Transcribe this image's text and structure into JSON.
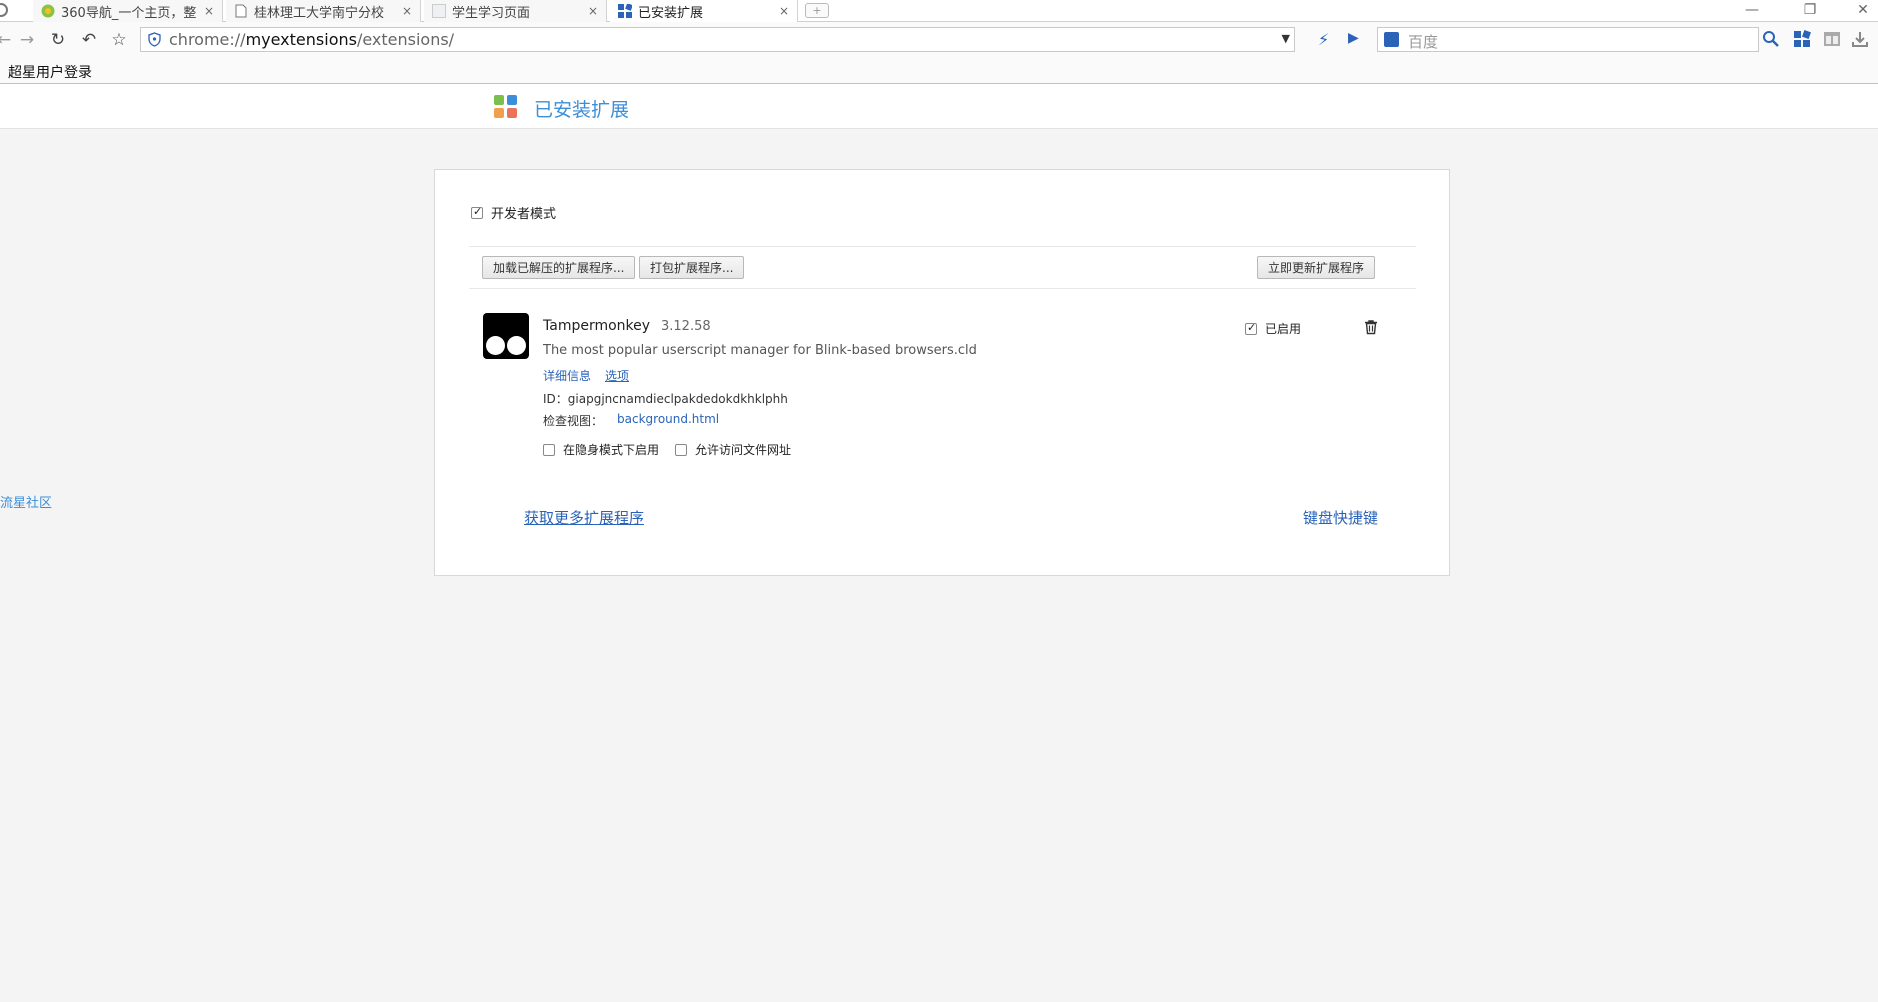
{
  "browser": {
    "tabs": [
      {
        "title": "360导航_一个主页，整",
        "favicon": "360-globe-icon"
      },
      {
        "title": "桂林理工大学南宁分校",
        "favicon": "page-icon"
      },
      {
        "title": "学生学习页面",
        "favicon": "blank-page-icon"
      },
      {
        "title": "已安装扩展",
        "favicon": "extensions-icon"
      }
    ],
    "tab_close_glyph": "×",
    "new_tab_glyph": "+",
    "address": {
      "scheme": "chrome://",
      "host": "myextensions",
      "path": "/extensions/"
    },
    "search_placeholder": "百度",
    "bookmarks": [
      {
        "label": "超星用户登录"
      }
    ]
  },
  "page": {
    "title": "已安装扩展",
    "side_link": "流星社区",
    "developer_mode": {
      "label": "开发者模式",
      "checked": true
    },
    "buttons": {
      "load_unpacked": "加载已解压的扩展程序...",
      "pack": "打包扩展程序...",
      "update_now": "立即更新扩展程序"
    },
    "extension": {
      "name": "Tampermonkey",
      "version": "3.12.58",
      "description": "The most popular userscript manager for Blink-based browsers.cld",
      "details_link": "详细信息",
      "options_link": "选项",
      "id_label": "ID：",
      "id_value": "giapgjncnamdieclpakdedokdkhklphh",
      "inspect_label": "检查视图：",
      "inspect_link": "background.html",
      "incognito_label": "在隐身模式下启用",
      "file_access_label": "允许访问文件网址",
      "enabled_label": "已启用",
      "enabled": true,
      "incognito": false,
      "file_access": false
    },
    "get_more": "获取更多扩展程序",
    "keyboard_shortcuts": "键盘快捷键"
  },
  "colors": {
    "accent": "#3b8ed8",
    "link": "#2a63b8"
  }
}
